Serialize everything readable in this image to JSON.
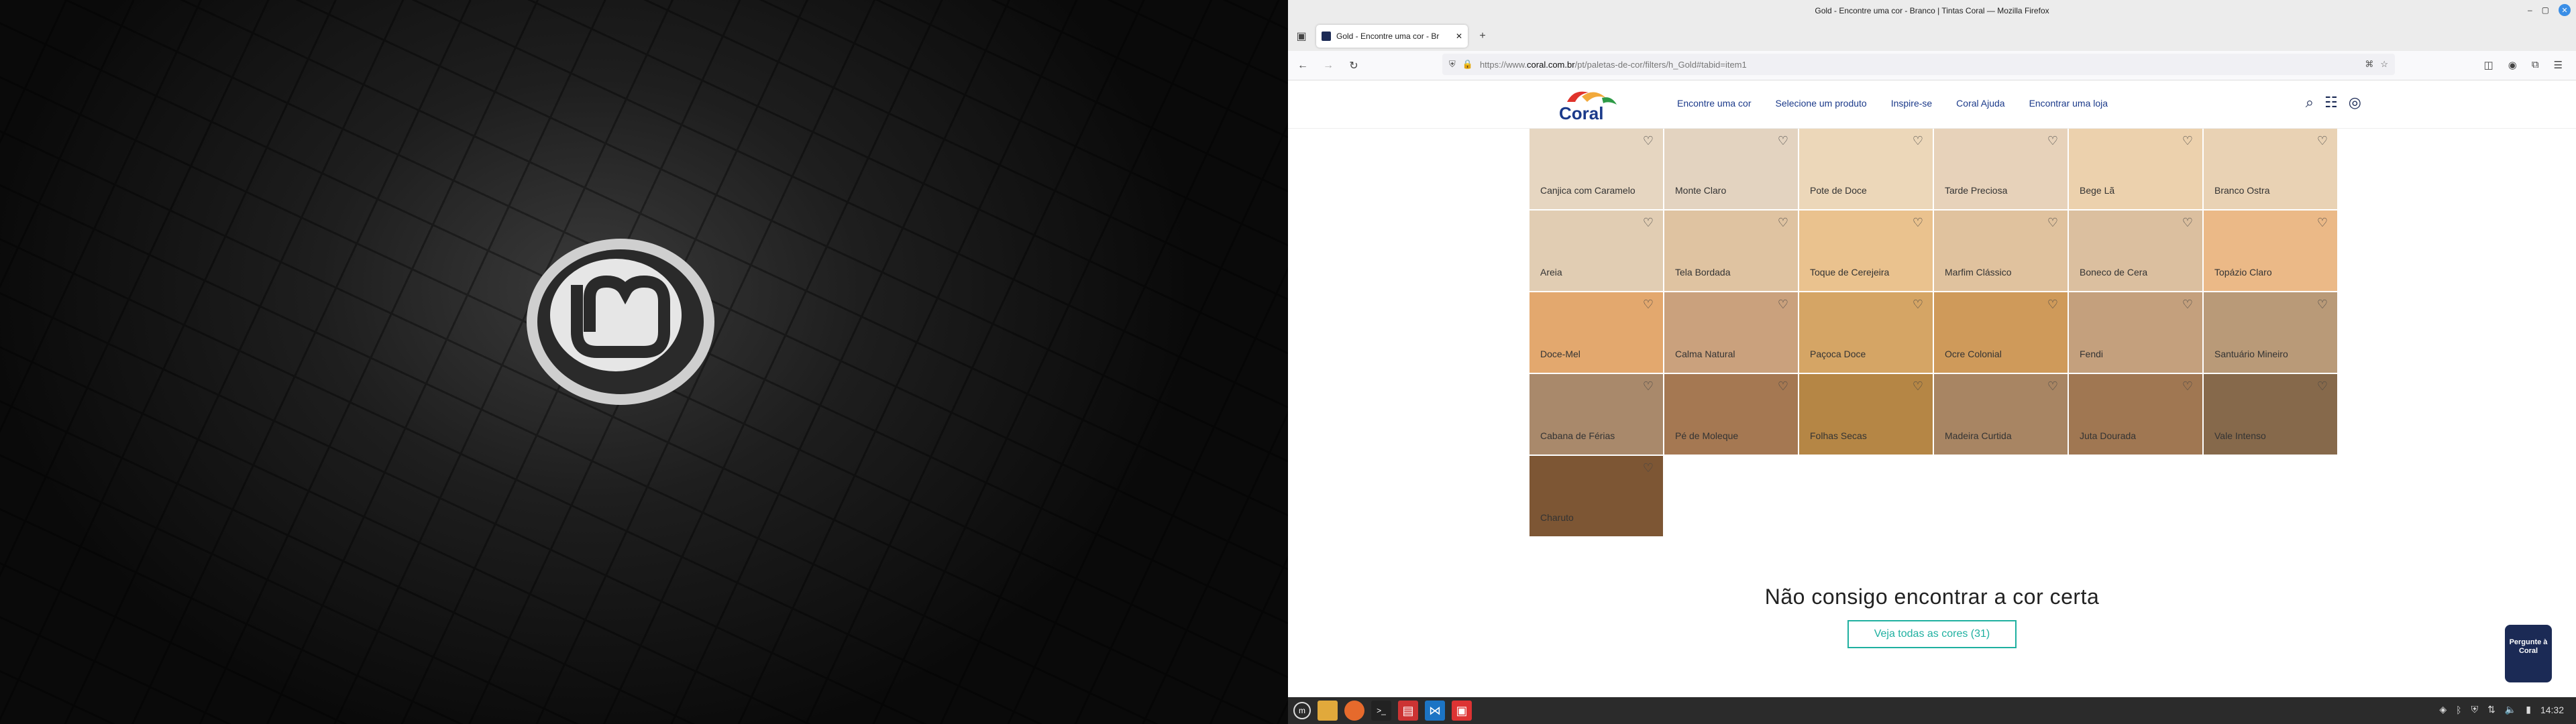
{
  "window": {
    "title": "Gold - Encontre uma cor - Branco | Tintas Coral — Mozilla Firefox"
  },
  "tab": {
    "title": "Gold - Encontre uma cor - Br"
  },
  "url": {
    "prefix": "https://www.",
    "domain": "coral.com.br",
    "path": "/pt/paletas-de-cor/filters/h_Gold#tabid=item1"
  },
  "site": {
    "logo_text": "Coral",
    "nav": [
      "Encontre uma cor",
      "Selecione um produto",
      "Inspire-se",
      "Coral Ajuda",
      "Encontrar uma loja"
    ]
  },
  "swatches": [
    {
      "name": "Canjica com Caramelo",
      "color": "#e6d6c1"
    },
    {
      "name": "Monte Claro",
      "color": "#e3d3c0"
    },
    {
      "name": "Pote de Doce",
      "color": "#ecd7b9"
    },
    {
      "name": "Tarde Preciosa",
      "color": "#e7d2ba"
    },
    {
      "name": "Bege Lã",
      "color": "#ecd1ad"
    },
    {
      "name": "Branco Ostra",
      "color": "#e9d2b4"
    },
    {
      "name": "Areia",
      "color": "#e1cdb3"
    },
    {
      "name": "Tela Bordada",
      "color": "#dfc3a1"
    },
    {
      "name": "Toque de Cerejeira",
      "color": "#eac28e"
    },
    {
      "name": "Marfim Clássico",
      "color": "#e0c29e"
    },
    {
      "name": "Boneco de Cera",
      "color": "#dbbf9f"
    },
    {
      "name": "Topázio Claro",
      "color": "#ebb987"
    },
    {
      "name": "Doce-Mel",
      "color": "#e3a86e"
    },
    {
      "name": "Calma Natural",
      "color": "#caa17d"
    },
    {
      "name": "Paçoca Doce",
      "color": "#d5a565"
    },
    {
      "name": "Ocre Colonial",
      "color": "#cf9a5a"
    },
    {
      "name": "Fendi",
      "color": "#c4a07d"
    },
    {
      "name": "Santuário Mineiro",
      "color": "#b99a78"
    },
    {
      "name": "Cabana de Férias",
      "color": "#a9896b"
    },
    {
      "name": "Pé de Moleque",
      "color": "#a57852"
    },
    {
      "name": "Folhas Secas",
      "color": "#b58645"
    },
    {
      "name": "Madeira Curtida",
      "color": "#a88563"
    },
    {
      "name": "Juta Dourada",
      "color": "#a07752"
    },
    {
      "name": "Vale Intenso",
      "color": "#86694b"
    },
    {
      "name": "Charuto",
      "color": "#7d5634"
    }
  ],
  "cta": {
    "heading": "Não consigo encontrar a cor certa",
    "button": "Veja todas as cores (31)"
  },
  "chat": {
    "label": "Pergunte à Coral"
  },
  "taskbar": {
    "clock": "14:32"
  }
}
